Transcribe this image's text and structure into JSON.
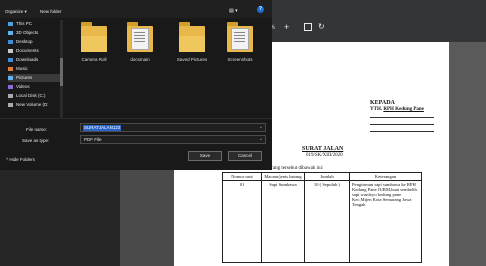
{
  "viewer": {
    "zoom": "0%",
    "zoom_plus": "+",
    "rotate_icon": "rotate-icon",
    "fit_icon": "fit-page-icon"
  },
  "dialog": {
    "toolbar": {
      "organize": "Organize ▾",
      "new_folder": "New folder",
      "view": "▤ ▾",
      "help": "?"
    },
    "nav": [
      {
        "label": "This PC",
        "icon": "pc-icon",
        "color": "#4aa3df"
      },
      {
        "label": "3D Objects",
        "icon": "cube-icon",
        "color": "#5fb3f0"
      },
      {
        "label": "Desktop",
        "icon": "desktop-icon",
        "color": "#3d8fd6"
      },
      {
        "label": "Documents",
        "icon": "documents-icon",
        "color": "#c8c8c8"
      },
      {
        "label": "Downloads",
        "icon": "downloads-icon",
        "color": "#3d8fd6"
      },
      {
        "label": "Music",
        "icon": "music-icon",
        "color": "#e07b39"
      },
      {
        "label": "Pictures",
        "icon": "pictures-icon",
        "color": "#5fb3f0"
      },
      {
        "label": "Videos",
        "icon": "videos-icon",
        "color": "#8f6ad8"
      },
      {
        "label": "Local Disk (C:)",
        "icon": "disk-icon",
        "color": "#aaaaaa"
      },
      {
        "label": "New Volume (D:",
        "icon": "disk-icon",
        "color": "#aaaaaa"
      }
    ],
    "folders": [
      {
        "label": "Camera Roll",
        "icon": "folder-icon"
      },
      {
        "label": "docsmain",
        "icon": "folder-documents-icon"
      },
      {
        "label": "Saved Pictures",
        "icon": "folder-icon"
      },
      {
        "label": "Screenshots",
        "icon": "folder-documents-icon"
      }
    ],
    "file_name_label": "File name:",
    "file_name_value": "SURATJALAN123",
    "save_as_type_label": "Save as type:",
    "save_as_type_value": "PDF File",
    "hide_folders": "^ Hide Folders",
    "save_button": "Save",
    "cancel_button": "Cancel"
  },
  "document": {
    "kepada": "KEPADA",
    "yth_prefix": "YTH. ",
    "yth_name": "RPH Kedung Pane",
    "title": "SURAT JALAN",
    "number": "019/SK/XIII/2020",
    "intro": "dikirimkan barang-barang tersebut dibawah ini:",
    "table": {
      "headers": [
        "Nomor urut",
        "Macam/jenis barang",
        "Jumlah",
        "Keterangan"
      ],
      "rows": [
        [
          "01",
          "Sapi Sumbawa",
          "10 ( Sepuluh )",
          "Pengiriman sapi sumbawa ke RPH Kedung Pane JURM,buat sembelih sapi wardoyo kedung pane Kec.Mijen Kota Semarang Jawa Tengah"
        ]
      ]
    }
  },
  "colors": {
    "accent": "#2a63c5",
    "dialog_bg": "#191919",
    "folder": "#e9b84a",
    "viewer_toolbar": "#323639"
  }
}
